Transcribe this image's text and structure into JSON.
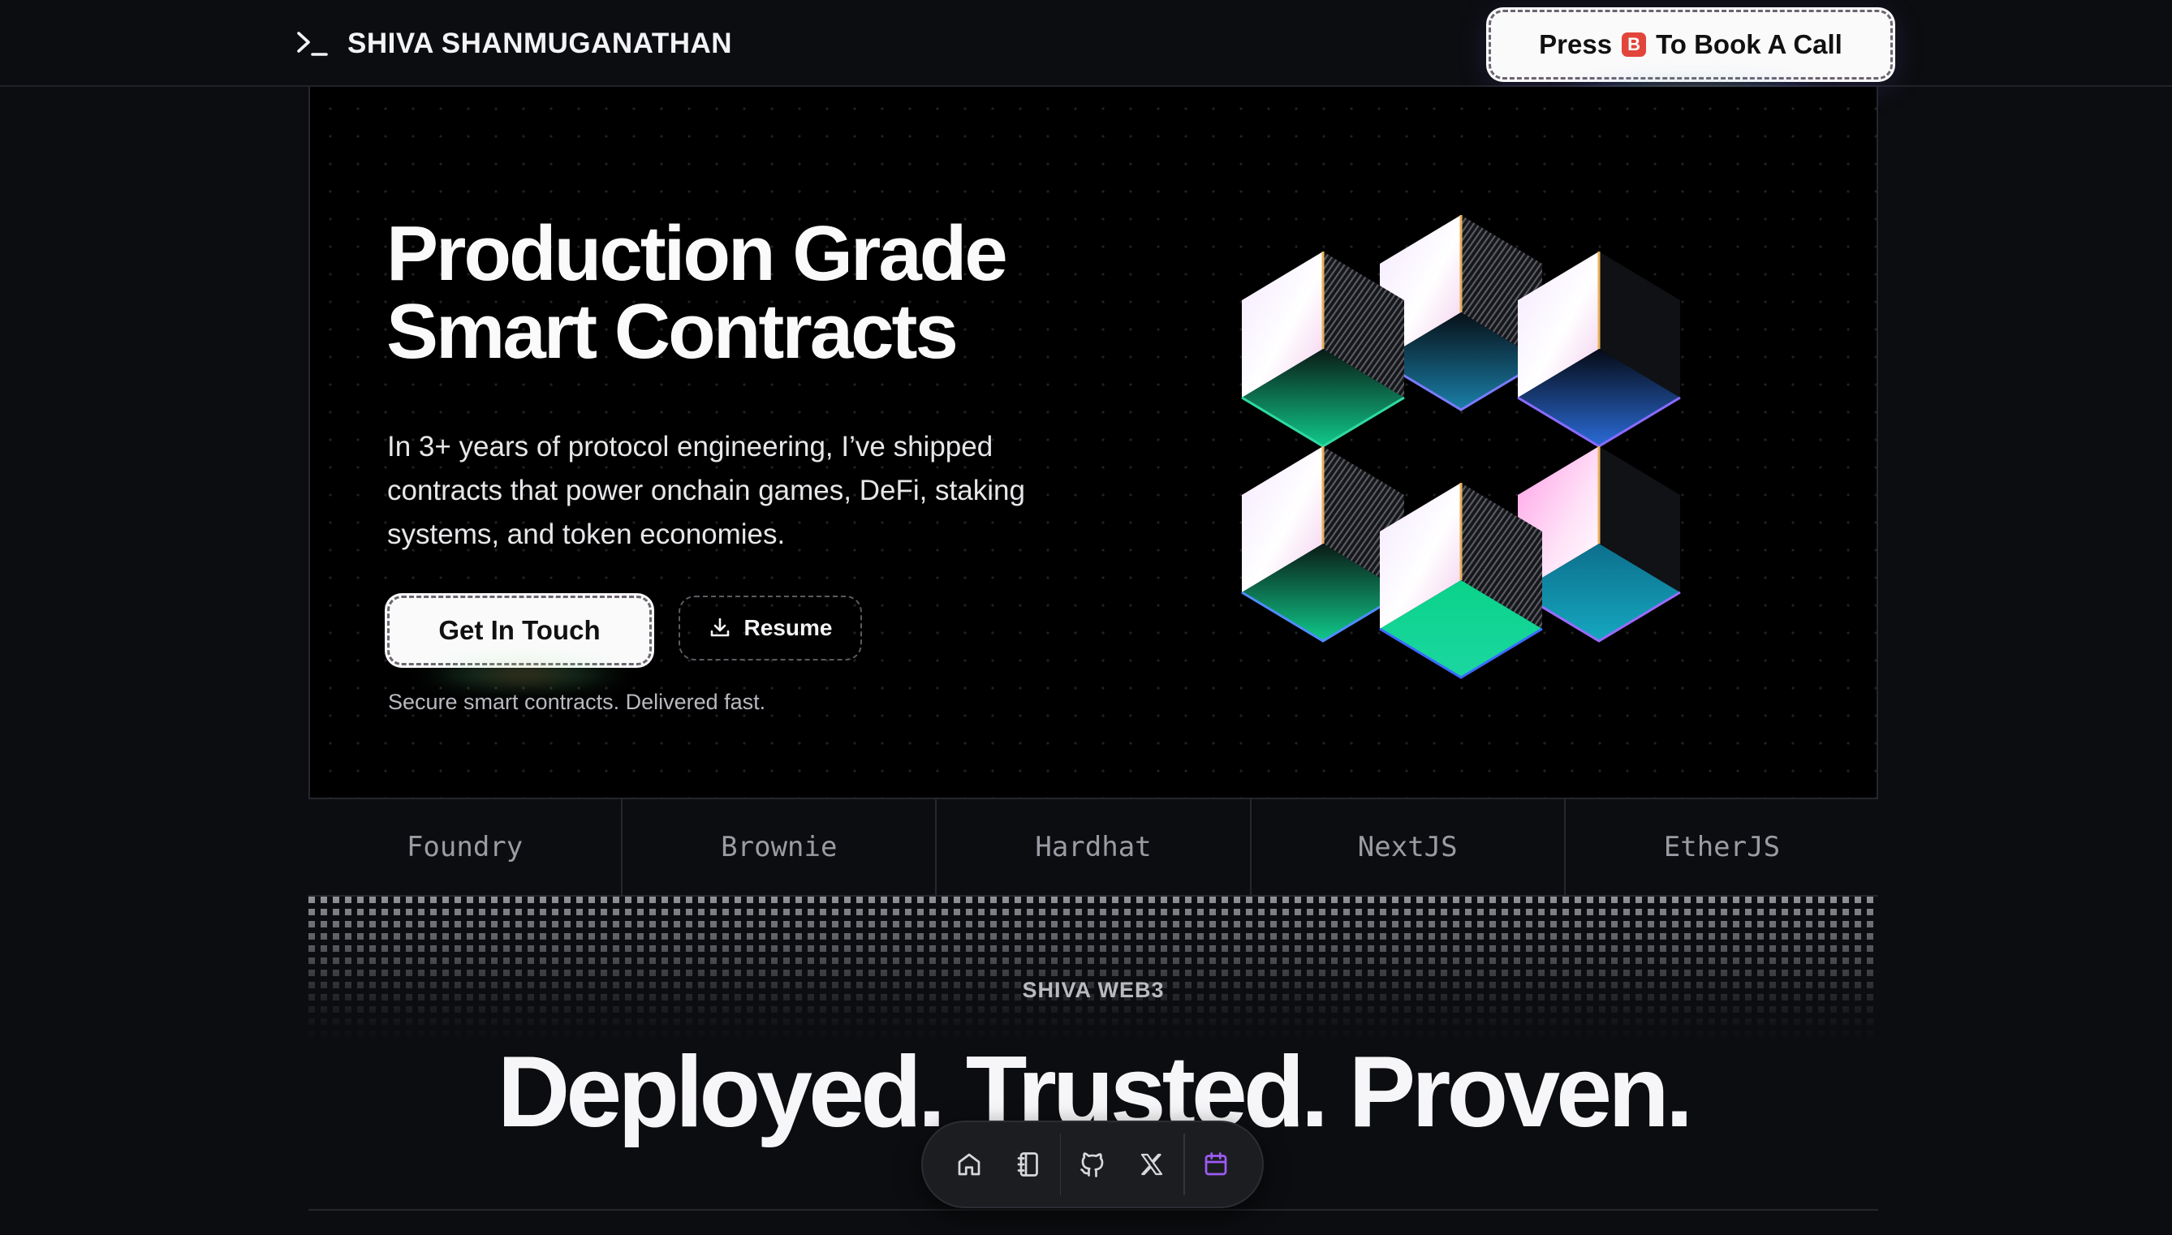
{
  "nav": {
    "brand_name": "SHIVA SHANMUGANATHAN",
    "brand_icon": "terminal-prompt-icon",
    "cta_prefix": "Press",
    "cta_key": "B",
    "cta_suffix": "To Book A Call"
  },
  "hero": {
    "headline_line1": "Production Grade",
    "headline_line2": "Smart Contracts",
    "intro": "In 3+ years of protocol engineering, I’ve shipped contracts that power onchain games, DeFi, staking systems, and token economies.",
    "primary_button": "Get In Touch",
    "secondary_button": "Resume",
    "secondary_icon": "download-icon",
    "tagline": "Secure smart contracts. Delivered fast."
  },
  "tools": [
    "Foundry",
    "Brownie",
    "Hardhat",
    "NextJS",
    "EtherJS"
  ],
  "proof": {
    "eyebrow": "SHIVA WEB3",
    "title": "Deployed. Trusted. Proven."
  },
  "dock": {
    "items": [
      "home-icon",
      "notebook-icon",
      "github-icon",
      "x-icon",
      "calendar-icon"
    ],
    "active_color": "#9d5cf5"
  },
  "colors": {
    "background": "#0c0d10",
    "hero_background": "#000000",
    "button_background": "#fafafa",
    "key_badge": "#e2453b"
  }
}
